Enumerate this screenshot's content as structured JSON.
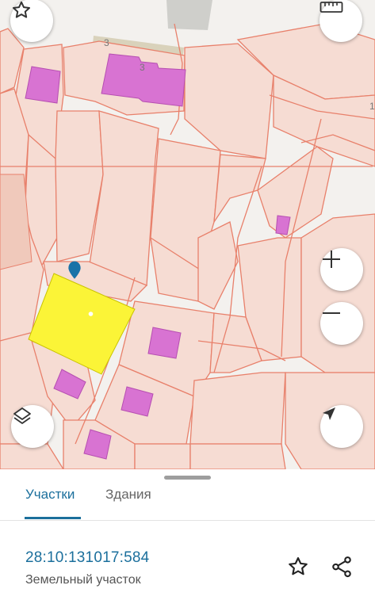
{
  "map": {
    "parcel_labels": [
      "3",
      "3",
      "1"
    ],
    "colors": {
      "parcel_fill": "#f6dcd3",
      "parcel_border": "#e8806b",
      "building_fill": "#d873d2",
      "selected_parcel": "#fbf437",
      "marker": "#1a73a8"
    },
    "controls": {
      "favorite_icon": "star-icon",
      "ruler_icon": "ruler-icon",
      "zoom_in_icon": "plus-icon",
      "zoom_out_icon": "minus-icon",
      "layers_icon": "layers-icon",
      "locate_icon": "navigation-arrow-icon"
    }
  },
  "sheet": {
    "tabs": [
      {
        "label": "Участки",
        "active": true
      },
      {
        "label": "Здания",
        "active": false
      }
    ],
    "parcel": {
      "cadastral_number": "28:10:131017:584",
      "type": "Земельный участок"
    },
    "actions": {
      "favorite_icon": "star-outline-icon",
      "share_icon": "share-icon"
    }
  }
}
